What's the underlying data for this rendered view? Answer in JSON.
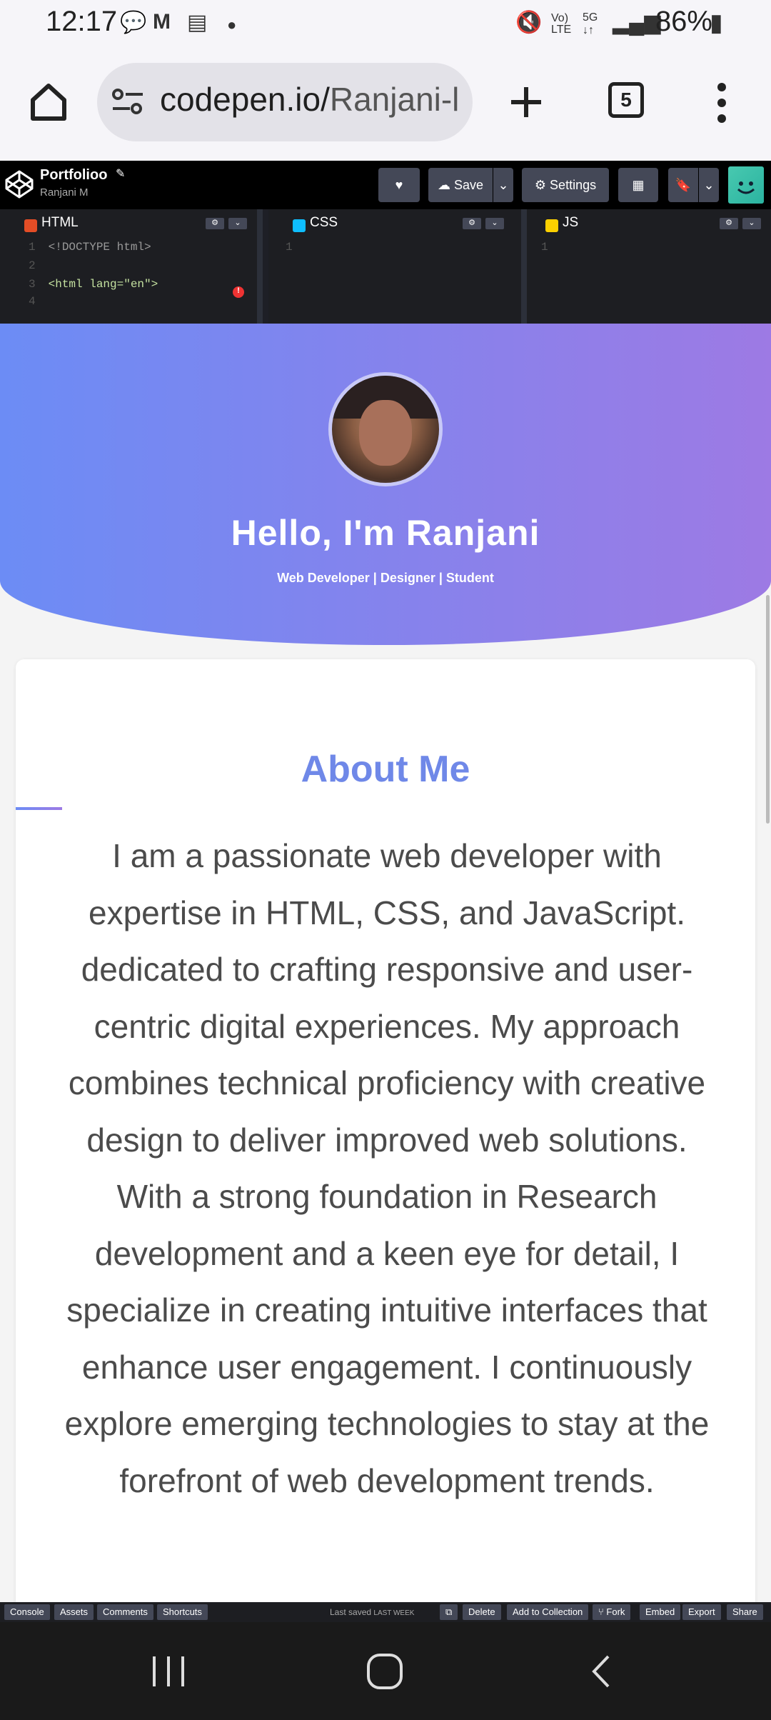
{
  "status": {
    "time": "12:17",
    "battery": "86%"
  },
  "browser": {
    "url_host": "codepen.io/",
    "url_path": "Ranjani-l",
    "tab_count": "5"
  },
  "codepen": {
    "pen_title": "Portfolioo",
    "author": "Ranjani M",
    "save_label": "Save",
    "settings_label": "Settings",
    "panels": [
      {
        "label": "HTML"
      },
      {
        "label": "CSS"
      },
      {
        "label": "JS"
      }
    ],
    "html_lines": [
      "<!DOCTYPE html>",
      "",
      "<html lang=\"en\">",
      ""
    ],
    "footer": {
      "console": "Console",
      "assets": "Assets",
      "comments": "Comments",
      "shortcuts": "Shortcuts",
      "last_saved": "Last saved",
      "last_saved_when": "LAST WEEK",
      "delete": "Delete",
      "add_to_collection": "Add to Collection",
      "fork": "Fork",
      "embed": "Embed",
      "export": "Export",
      "share": "Share"
    }
  },
  "preview": {
    "hero_title": "Hello, I'm Ranjani",
    "hero_subtitle": "Web Developer | Designer | Student",
    "about_title": "About Me",
    "about_p1": "I am a passionate web developer with expertise in HTML, CSS, and JavaScript. dedicated to crafting responsive and user-centric digital experiences. My approach combines technical proficiency with creative design to deliver improved web solutions.",
    "about_p2": "With a strong foundation in Research development and a keen eye for detail, I specialize in creating intuitive interfaces that enhance user engagement. I continuously explore emerging technologies to stay at the forefront of web development trends."
  },
  "colors": {
    "hero_start": "#6c8cf5",
    "hero_end": "#9d7ae4",
    "about_title": "#6f88e8"
  }
}
